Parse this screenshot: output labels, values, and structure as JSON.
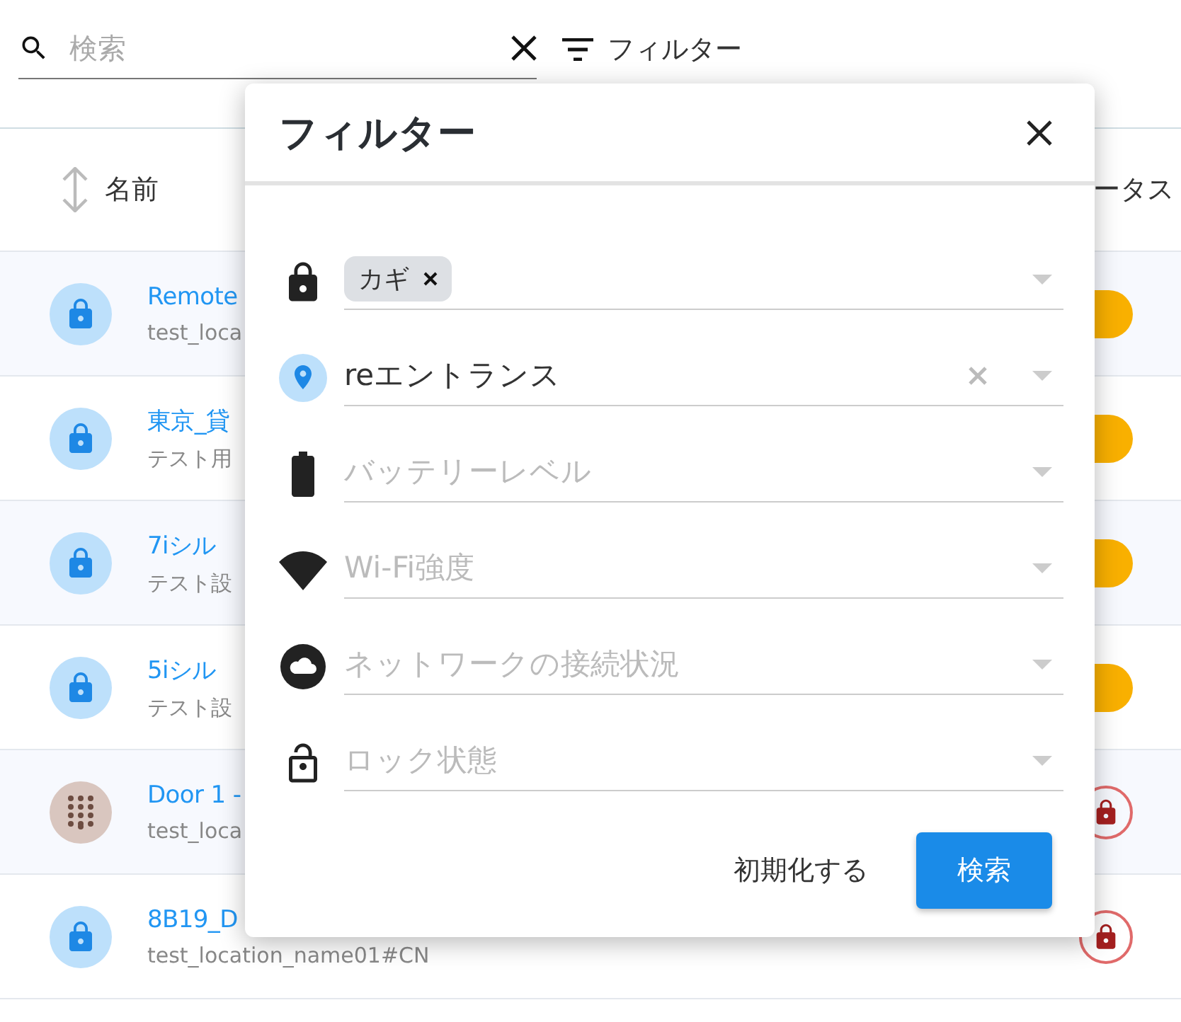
{
  "search": {
    "placeholder": "検索"
  },
  "filter_button": {
    "label": "フィルター"
  },
  "table": {
    "columns": [
      {
        "label": "名前",
        "sortable": true
      },
      {
        "label": "ータス",
        "sortable": false
      }
    ],
    "rows": [
      {
        "avatar": {
          "kind": "lock"
        },
        "name": "Remote",
        "location": "test_loca",
        "status": {
          "kind": "pending"
        }
      },
      {
        "avatar": {
          "kind": "lock"
        },
        "name": "東京_貸",
        "location": "テスト用",
        "status": {
          "kind": "pending"
        }
      },
      {
        "avatar": {
          "kind": "lock"
        },
        "name": "7iシル",
        "location": "テスト設",
        "status": {
          "kind": "pending"
        }
      },
      {
        "avatar": {
          "kind": "lock"
        },
        "name": "5iシル",
        "location": "テスト設",
        "status": {
          "kind": "pending"
        }
      },
      {
        "avatar": {
          "kind": "keypad"
        },
        "name": "Door 1 -",
        "location": "test_loca",
        "status": {
          "kind": "locked"
        }
      },
      {
        "avatar": {
          "kind": "lock"
        },
        "name": "8B19_D",
        "location": "test_location_name01#CN",
        "status": {
          "kind": "locked"
        }
      }
    ]
  },
  "dialog": {
    "title": "フィルター",
    "fields": [
      {
        "kind": "lock",
        "chips": [
          "カギ"
        ]
      },
      {
        "kind": "pin",
        "value": "reエントランス"
      },
      {
        "kind": "battery",
        "placeholder": "バッテリーレベル"
      },
      {
        "kind": "wifi",
        "placeholder": "Wi-Fi強度"
      },
      {
        "kind": "cloud",
        "placeholder": "ネットワークの接続状況"
      },
      {
        "kind": "unlock",
        "placeholder": "ロック状態"
      }
    ],
    "reset_button": "初期化する",
    "search_button": "検索"
  }
}
